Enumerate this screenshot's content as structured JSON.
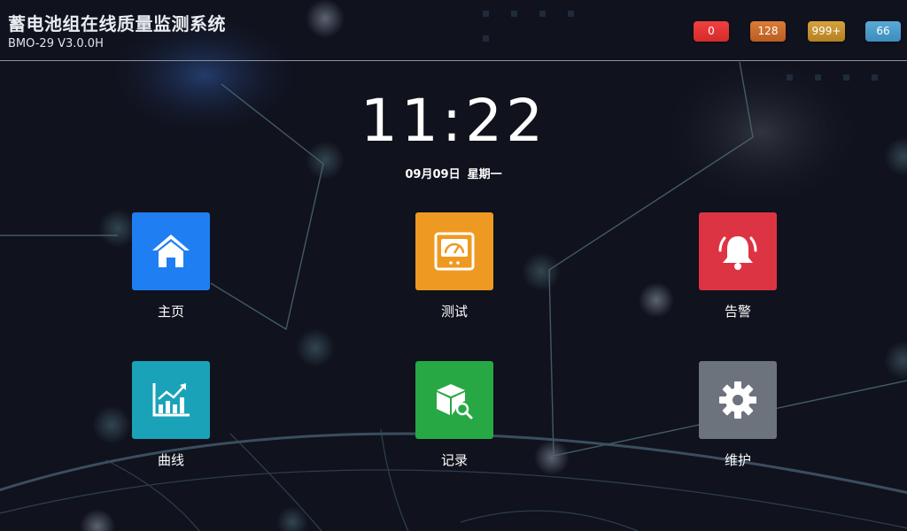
{
  "header": {
    "title": "蓄电池组在线质量监测系统",
    "version": "BMO-29 V3.0.0H",
    "badges": [
      {
        "value": "0",
        "color": "#e53535"
      },
      {
        "value": "128",
        "color": "#c96a2b"
      },
      {
        "value": "999+",
        "color": "#c4902e"
      },
      {
        "value": "66",
        "color": "#4b9bc9"
      }
    ]
  },
  "clock": {
    "time": "11:22",
    "date": "09月09日",
    "weekday": "星期一"
  },
  "menu": [
    {
      "label": "主页",
      "icon": "home-icon",
      "color": "#1f7ff2"
    },
    {
      "label": "测试",
      "icon": "gauge-icon",
      "color": "#ee9a22"
    },
    {
      "label": "告警",
      "icon": "bell-icon",
      "color": "#dd3444"
    },
    {
      "label": "曲线",
      "icon": "chart-icon",
      "color": "#1aa3b8"
    },
    {
      "label": "记录",
      "icon": "box-search-icon",
      "color": "#27a844"
    },
    {
      "label": "维护",
      "icon": "gear-icon",
      "color": "#6c737d"
    }
  ]
}
